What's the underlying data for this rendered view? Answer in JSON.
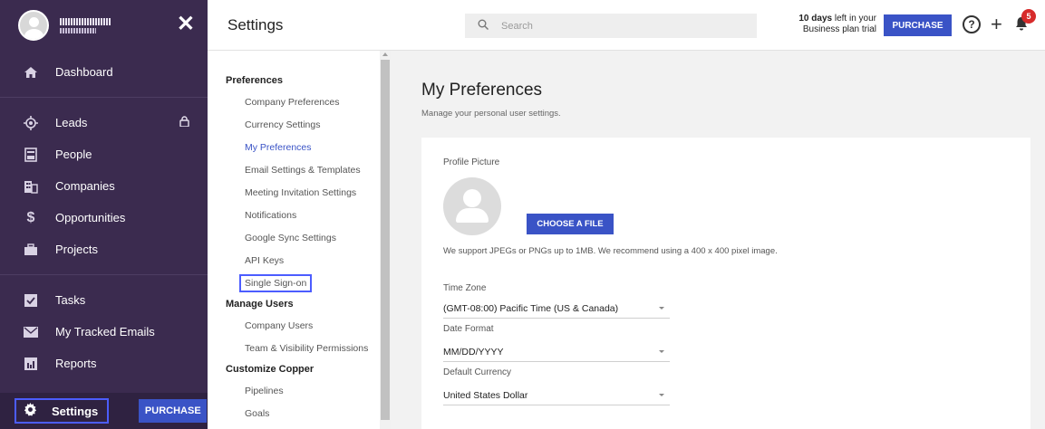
{
  "sidebar": {
    "user_name": "",
    "user_subtitle": "",
    "close_glyph": "✕",
    "items": [
      {
        "label": "Dashboard",
        "icon": "home-icon"
      },
      {
        "label": "Leads",
        "icon": "target-icon",
        "locked": true
      },
      {
        "label": "People",
        "icon": "person-card-icon"
      },
      {
        "label": "Companies",
        "icon": "building-icon"
      },
      {
        "label": "Opportunities",
        "icon": "dollar-icon"
      },
      {
        "label": "Projects",
        "icon": "briefcase-icon"
      },
      {
        "label": "Tasks",
        "icon": "checkbox-icon"
      },
      {
        "label": "My Tracked Emails",
        "icon": "envelope-icon"
      },
      {
        "label": "Reports",
        "icon": "bar-chart-icon"
      }
    ],
    "settings_label": "Settings",
    "purchase_label": "PURCHASE"
  },
  "header": {
    "title": "Settings",
    "search_placeholder": "Search",
    "trial_bold": "10 days",
    "trial_rest1": " left in your",
    "trial_line2": "Business plan trial",
    "purchase_label": "PURCHASE",
    "help_glyph": "?",
    "plus_glyph": "+",
    "notification_count": "5"
  },
  "subnav": {
    "sections": [
      {
        "heading": "Preferences",
        "items": [
          "Company Preferences",
          "Currency Settings",
          "My Preferences",
          "Email Settings & Templates",
          "Meeting Invitation Settings",
          "Notifications",
          "Google Sync Settings",
          "API Keys",
          "Single Sign-on"
        ]
      },
      {
        "heading": "Manage Users",
        "items": [
          "Company Users",
          "Team & Visibility Permissions"
        ]
      },
      {
        "heading": "Customize Copper",
        "items": [
          "Pipelines",
          "Goals"
        ]
      }
    ],
    "active_item": "My Preferences",
    "highlighted_item": "Single Sign-on"
  },
  "main": {
    "title": "My Preferences",
    "subtitle": "Manage your personal user settings.",
    "profile_label": "Profile Picture",
    "choose_label": "CHOOSE A FILE",
    "support_text": "We support JPEGs or PNGs up to 1MB. We recommend using a 400 x 400 pixel image.",
    "timezone_label": "Time Zone",
    "timezone_value": "(GMT-08:00) Pacific Time (US & Canada)",
    "dateformat_label": "Date Format",
    "dateformat_value": "MM/DD/YYYY",
    "currency_label": "Default Currency",
    "currency_value": "United States Dollar"
  }
}
